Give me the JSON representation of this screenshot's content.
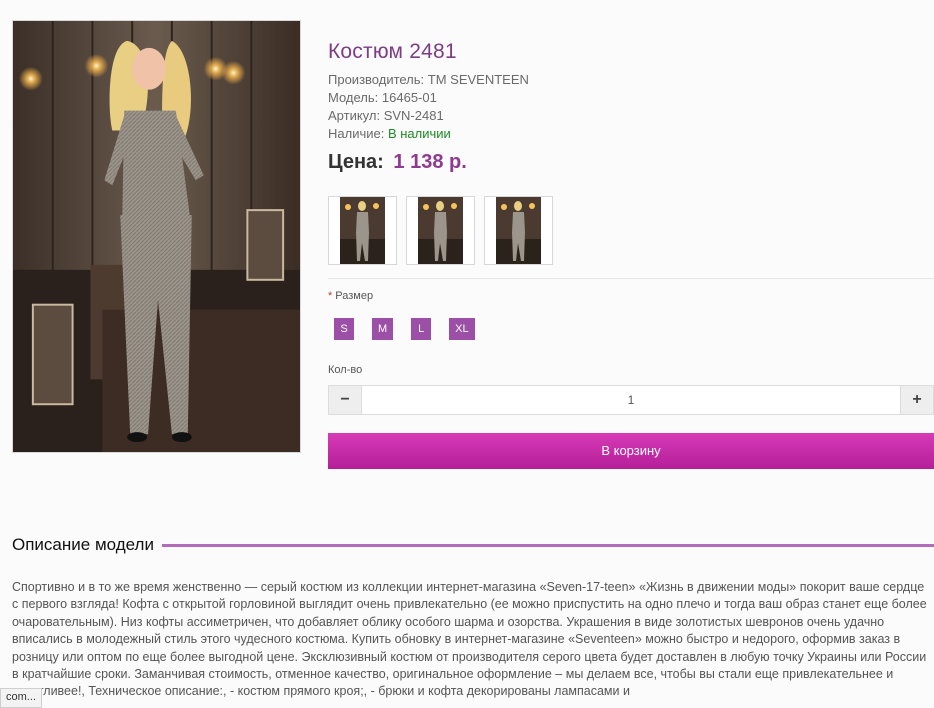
{
  "product": {
    "title": "Костюм 2481",
    "manufacturer_label": "Производитель:",
    "manufacturer": "TM SEVENTEEN",
    "model_label": "Модель:",
    "model": "16465-01",
    "sku_label": "Артикул:",
    "sku": "SVN-2481",
    "availability_label": "Наличие:",
    "availability": "В наличии",
    "price_label": "Цена:",
    "price": "1 138 р."
  },
  "options": {
    "size_label": "Размер",
    "sizes": [
      "S",
      "M",
      "L",
      "XL"
    ],
    "qty_label": "Кол-во",
    "qty_value": "1",
    "minus": "−",
    "plus": "+",
    "cart_button": "В корзину"
  },
  "description": {
    "heading": "Описание модели",
    "text": "Спортивно и в то же время женственно — серый костюм из коллекции интернет-магазина «Seven-17-teen» «Жизнь в движении моды» покорит ваше сердце с первого взгляда! Кофта с открытой горловиной выглядит очень привлекательно (ее можно приспустить на одно плечо и тогда ваш образ станет еще более очаровательным). Низ кофты ассиметричен, что добавляет облику особого шарма и озорства. Украшения в виде золотистых шевронов очень удачно вписались в молодежный стиль этого чудесного костюма. Купить обновку в интернет-магазине «Seventeen» можно быстро и недорого, оформив заказ в розницу или оптом по еще более выгодной цене. Эксклюзивный костюм от производителя серого цвета будет доставлен в любую точку Украины или России в кратчайшие сроки. Заманчивая стоимость, отменное качество, оригинальное оформление – мы делаем все, чтобы вы стали еще привлекательнее и счастливее!, Техническое описание:, - костюм прямого кроя;, - брюки и кофта декорированы лампасами и"
  },
  "status_tooltip": "com...",
  "colors": {
    "title": "#7d3d86",
    "price": "#8e3a91",
    "size_button": "#9b4fa6",
    "cart_button": "#c22aa6",
    "in_stock": "#1c8a22",
    "heading_rule": "#b56bbb"
  }
}
